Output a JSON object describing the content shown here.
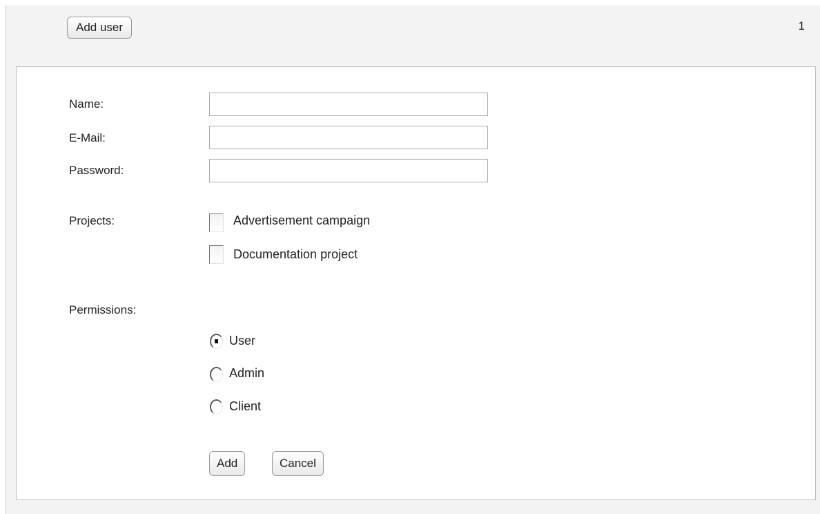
{
  "toolbar": {
    "add_user_label": "Add user",
    "counter": "1"
  },
  "form": {
    "name_label": "Name:",
    "name_value": "",
    "email_label": "E-Mail:",
    "email_value": "",
    "password_label": "Password:",
    "password_value": "",
    "projects_label": "Projects:",
    "projects": [
      {
        "label": "Advertisement campaign",
        "checked": false
      },
      {
        "label": "Documentation project",
        "checked": false
      }
    ],
    "permissions_label": "Permissions:",
    "permissions": [
      {
        "label": "User",
        "selected": true
      },
      {
        "label": "Admin",
        "selected": false
      },
      {
        "label": "Client",
        "selected": false
      }
    ],
    "add_label": "Add",
    "cancel_label": "Cancel"
  }
}
